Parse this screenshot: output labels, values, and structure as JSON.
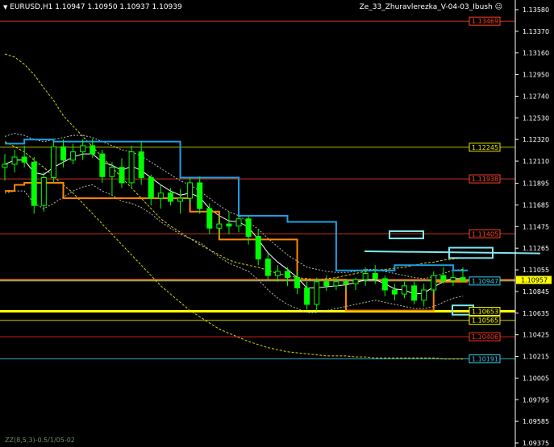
{
  "header": {
    "arrow": "▼",
    "symbol": "EURUSD,H1",
    "ohlc": "1.10947 1.10950 1.10937 1.10939",
    "indicator": "Ze_33_Zhuravlerezka_V-04-03_Ibush",
    "smiley": "☺"
  },
  "footer": {
    "label": "ZZ(8,5,3)-0.5/1/05-02"
  },
  "colors": {
    "background": "#000000",
    "candle": "#00ff00",
    "axis": "#ffffff",
    "fast_ma": "#ffffff",
    "band_yellow": "#d8d800",
    "band_white": "#bbbbbb",
    "orange_step": "#ff8800",
    "blue_step": "#1ea0e6"
  },
  "chart_data": {
    "type": "line",
    "title": "EURUSD,H1",
    "yaxis": {
      "min": 1.09375,
      "max": 1.1358,
      "side": "right",
      "ticks": [
        "1.13580",
        "1.13370",
        "1.13160",
        "1.12950",
        "1.12740",
        "1.12530",
        "1.12320",
        "1.12110",
        "1.11895",
        "1.11685",
        "1.11475",
        "1.11265",
        "1.11055",
        "1.10845",
        "1.10635",
        "1.10425",
        "1.10215",
        "1.10005",
        "1.09795",
        "1.09585",
        "1.09375"
      ]
    },
    "levels": [
      {
        "label": "1.13469",
        "value": 1.13469,
        "color": "#ff4422",
        "style": "line"
      },
      {
        "label": "1.12245",
        "value": 1.12245,
        "color": "#e8e800",
        "style": "line"
      },
      {
        "label": "1.11938",
        "value": 1.11938,
        "color": "#ff4422",
        "style": "line"
      },
      {
        "label": "1.11405",
        "value": 1.11405,
        "color": "#ff4422",
        "style": "line"
      },
      {
        "label": "1.10947",
        "value": 1.10947,
        "color": "#3cc8e6",
        "style": "line"
      },
      {
        "label": "1.10653",
        "value": 1.10653,
        "color": "#ffff00",
        "style": "bold"
      },
      {
        "label": "1.10565",
        "value": 1.10565,
        "color": "#ffff00",
        "style": "line"
      },
      {
        "label": "1.10406",
        "value": 1.10406,
        "color": "#ff3322",
        "style": "line"
      },
      {
        "label": "1.10191",
        "value": 1.10191,
        "color": "#3cc8e6",
        "style": "line"
      }
    ],
    "current_price": {
      "label": "1.10957",
      "value": 1.10957
    },
    "orange_hline": {
      "value": 1.10957,
      "color": "#ff8800"
    },
    "candles": [
      [
        1.1205,
        1.1218,
        1.1192,
        1.1208
      ],
      [
        1.1208,
        1.1222,
        1.12,
        1.1215
      ],
      [
        1.1215,
        1.1226,
        1.1205,
        1.121
      ],
      [
        1.121,
        1.1215,
        1.116,
        1.1168
      ],
      [
        1.1168,
        1.12,
        1.1162,
        1.1195
      ],
      [
        1.1195,
        1.123,
        1.119,
        1.1225
      ],
      [
        1.1225,
        1.1232,
        1.1205,
        1.1212
      ],
      [
        1.1212,
        1.1228,
        1.1208,
        1.122
      ],
      [
        1.122,
        1.1232,
        1.1212,
        1.1226
      ],
      [
        1.1226,
        1.1233,
        1.1214,
        1.1218
      ],
      [
        1.1218,
        1.1222,
        1.119,
        1.1196
      ],
      [
        1.1196,
        1.121,
        1.1178,
        1.1205
      ],
      [
        1.1205,
        1.1214,
        1.1185,
        1.119
      ],
      [
        1.119,
        1.1226,
        1.1186,
        1.122
      ],
      [
        1.122,
        1.123,
        1.1188,
        1.1195
      ],
      [
        1.1195,
        1.1198,
        1.1168,
        1.1175
      ],
      [
        1.1175,
        1.1188,
        1.1165,
        1.118
      ],
      [
        1.118,
        1.1185,
        1.1168,
        1.1172
      ],
      [
        1.1172,
        1.1184,
        1.116,
        1.1175
      ],
      [
        1.1175,
        1.1195,
        1.117,
        1.119
      ],
      [
        1.119,
        1.1196,
        1.116,
        1.1165
      ],
      [
        1.1165,
        1.117,
        1.114,
        1.1146
      ],
      [
        1.1146,
        1.1158,
        1.1138,
        1.115
      ],
      [
        1.115,
        1.1162,
        1.114,
        1.1148
      ],
      [
        1.1148,
        1.1158,
        1.1142,
        1.1155
      ],
      [
        1.1155,
        1.1158,
        1.113,
        1.1138
      ],
      [
        1.1138,
        1.1145,
        1.111,
        1.1116
      ],
      [
        1.1116,
        1.1122,
        1.1096,
        1.11
      ],
      [
        1.11,
        1.111,
        1.1094,
        1.1104
      ],
      [
        1.1104,
        1.1108,
        1.109,
        1.1098
      ],
      [
        1.1098,
        1.1104,
        1.1082,
        1.1088
      ],
      [
        1.1088,
        1.1094,
        1.1067,
        1.1072
      ],
      [
        1.1072,
        1.1098,
        1.1066,
        1.1094
      ],
      [
        1.1094,
        1.11,
        1.1085,
        1.109
      ],
      [
        1.109,
        1.1098,
        1.1086,
        1.1094
      ],
      [
        1.1094,
        1.1096,
        1.1086,
        1.1092
      ],
      [
        1.1092,
        1.1098,
        1.1086,
        1.1096
      ],
      [
        1.1096,
        1.1108,
        1.109,
        1.1102
      ],
      [
        1.1102,
        1.111,
        1.1092,
        1.1097
      ],
      [
        1.1097,
        1.11,
        1.108,
        1.1086
      ],
      [
        1.1086,
        1.1092,
        1.1076,
        1.1082
      ],
      [
        1.1082,
        1.1094,
        1.1078,
        1.109
      ],
      [
        1.109,
        1.1094,
        1.1072,
        1.1076
      ],
      [
        1.1076,
        1.1092,
        1.107,
        1.1086
      ],
      [
        1.1086,
        1.1104,
        1.1082,
        1.11
      ],
      [
        1.11,
        1.1108,
        1.1092,
        1.1095
      ],
      [
        1.1095,
        1.1104,
        1.109,
        1.1098
      ],
      [
        1.1098,
        1.1108,
        1.1094,
        1.1095
      ]
    ],
    "fast_ma": [
      1.1208,
      1.1212,
      1.1212,
      1.12,
      1.1198,
      1.1205,
      1.121,
      1.1215,
      1.1218,
      1.1218,
      1.121,
      1.1207,
      1.1202,
      1.1206,
      1.1202,
      1.1195,
      1.1188,
      1.1182,
      1.1178,
      1.118,
      1.1176,
      1.1165,
      1.1158,
      1.1153,
      1.1152,
      1.1147,
      1.1135,
      1.1122,
      1.1113,
      1.1106,
      1.1098,
      1.1088,
      1.1088,
      1.1089,
      1.109,
      1.1091,
      1.1093,
      1.1096,
      1.1096,
      1.1092,
      1.1087,
      1.1086,
      1.1082,
      1.1083,
      1.1089,
      1.1094,
      1.1097,
      1.1097
    ],
    "band_yellow_upper": [
      1.1315,
      1.1312,
      1.1305,
      1.1295,
      1.1282,
      1.127,
      1.1255,
      1.1245,
      1.1235,
      1.1225,
      1.1215,
      1.1205,
      1.1195,
      1.1185,
      1.1175,
      1.1165,
      1.1155,
      1.1148,
      1.1142,
      1.1136,
      1.113,
      1.1125,
      1.112,
      1.1115,
      1.1112,
      1.111,
      1.1108,
      1.1105,
      1.1102,
      1.11,
      1.1098,
      1.1097,
      1.1096,
      1.1097,
      1.1098,
      1.11,
      1.1102,
      1.1104,
      1.1105,
      1.1106,
      1.1107,
      1.1108,
      1.111,
      1.1112,
      1.1113,
      1.1115,
      1.1116,
      1.1117
    ],
    "band_yellow_lower": [
      1.123,
      1.1225,
      1.122,
      1.1212,
      1.1205,
      1.1196,
      1.1188,
      1.118,
      1.117,
      1.116,
      1.115,
      1.114,
      1.113,
      1.112,
      1.111,
      1.11,
      1.109,
      1.1082,
      1.1074,
      1.1066,
      1.106,
      1.1054,
      1.1048,
      1.1044,
      1.104,
      1.1036,
      1.1033,
      1.103,
      1.1028,
      1.1026,
      1.1025,
      1.1024,
      1.1023,
      1.1022,
      1.1022,
      1.1022,
      1.1021,
      1.1021,
      1.102,
      1.102,
      1.102,
      1.102,
      1.102,
      1.102,
      1.102,
      1.1019,
      1.1019,
      1.1019
    ],
    "band_white_upper": [
      1.1235,
      1.1238,
      1.1236,
      1.1232,
      1.123,
      1.1232,
      1.1234,
      1.1236,
      1.1236,
      1.1234,
      1.123,
      1.1226,
      1.1222,
      1.122,
      1.1216,
      1.121,
      1.1204,
      1.1198,
      1.1192,
      1.1188,
      1.1182,
      1.1175,
      1.1168,
      1.1162,
      1.1158,
      1.1152,
      1.1145,
      1.1136,
      1.1128,
      1.112,
      1.1114,
      1.1108,
      1.1106,
      1.1104,
      1.1103,
      1.1103,
      1.1104,
      1.1106,
      1.1106,
      1.1104,
      1.1102,
      1.11,
      1.1098,
      1.1097,
      1.1099,
      1.1102,
      1.1105,
      1.1106
    ],
    "band_white_lower": [
      1.118,
      1.1182,
      1.1182,
      1.117,
      1.1165,
      1.117,
      1.1176,
      1.1182,
      1.1186,
      1.1188,
      1.1182,
      1.1178,
      1.1172,
      1.117,
      1.1166,
      1.116,
      1.1152,
      1.1146,
      1.114,
      1.1136,
      1.1132,
      1.1125,
      1.1118,
      1.1112,
      1.1108,
      1.1104,
      1.1096,
      1.1086,
      1.1078,
      1.1072,
      1.1068,
      1.1064,
      1.1064,
      1.1066,
      1.1068,
      1.107,
      1.1072,
      1.1074,
      1.1076,
      1.1074,
      1.1072,
      1.107,
      1.1068,
      1.1068,
      1.107,
      1.1074,
      1.1078,
      1.108
    ],
    "orange_step": [
      1.1182,
      1.1188,
      1.119,
      1.119,
      1.119,
      1.119,
      1.1175,
      1.1175,
      1.1175,
      1.1175,
      1.1175,
      1.1175,
      1.1175,
      1.1175,
      1.1175,
      1.1175,
      1.1175,
      1.1175,
      1.1175,
      1.1162,
      1.1162,
      1.1162,
      1.1135,
      1.1135,
      1.1135,
      1.1135,
      1.1135,
      1.1135,
      1.1135,
      1.1135,
      1.1096,
      1.1096,
      1.1096,
      1.1096,
      1.1096,
      1.1066,
      1.1066,
      1.1066,
      1.1066,
      1.1066,
      1.1066,
      1.1066,
      1.1066,
      1.1066,
      1.1094,
      1.1094,
      1.1094,
      1.1094
    ],
    "blue_step": [
      1.1228,
      1.1228,
      1.1232,
      1.1232,
      1.1232,
      1.123,
      1.123,
      1.123,
      1.123,
      1.123,
      1.123,
      1.123,
      1.123,
      1.123,
      1.123,
      1.123,
      1.123,
      1.123,
      1.1195,
      1.1195,
      1.1195,
      1.1195,
      1.1195,
      1.1195,
      1.1158,
      1.1158,
      1.1158,
      1.1158,
      1.1158,
      1.1152,
      1.1152,
      1.1152,
      1.1152,
      1.1152,
      1.1105,
      1.1105,
      1.1105,
      1.1105,
      1.1105,
      1.1105,
      1.111,
      1.111,
      1.111,
      1.111,
      1.111,
      1.111,
      1.1105,
      1.1105
    ],
    "zones": [
      {
        "from": 1.1136,
        "to": 1.1143,
        "color": "#7fe8f0",
        "pos": "mid"
      },
      {
        "from": 1.1117,
        "to": 1.1127,
        "color": "#7fe8f0",
        "pos": "right"
      },
      {
        "from": 1.1062,
        "to": 1.1071,
        "color": "#7fe8f0",
        "pos": "edge"
      }
    ],
    "grid": false,
    "legend": "none"
  }
}
